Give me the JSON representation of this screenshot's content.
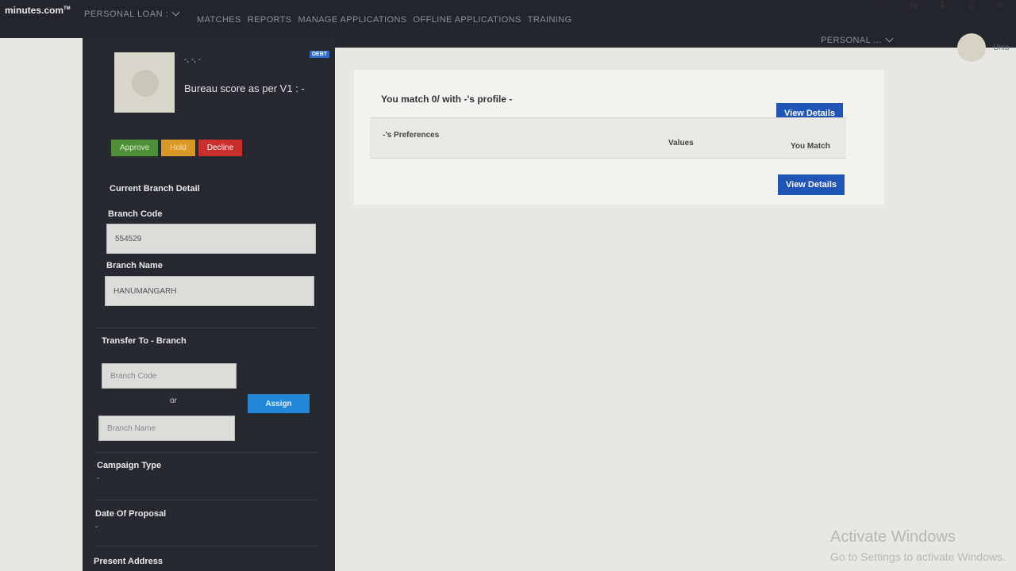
{
  "browser": {
    "icons": [
      "star-icon",
      "reader-icon",
      "download-icon",
      "home-icon",
      "menu-icon"
    ]
  },
  "nav": {
    "logo": "minutes.com",
    "logo_tm": "TM",
    "product": "PERSONAL LOAN :",
    "links": [
      "MATCHES",
      "REPORTS",
      "MANAGE APPLICATIONS",
      "OFFLINE APPLICATIONS",
      "TRAINING"
    ],
    "user_menu": "PERSONAL ...",
    "user_name": "Unio"
  },
  "sidebar": {
    "profile_dots": "-, -, -",
    "badge": "DEBT",
    "bureau_score": "Bureau score as per V1 : -",
    "actions": {
      "approve": "Approve",
      "hold": "Hold",
      "decline": "Decline"
    },
    "current_branch_title": "Current Branch Detail",
    "branch_code_label": "Branch Code",
    "branch_code_value": "554529",
    "branch_name_label": "Branch Name",
    "branch_name_value": "HANUMANGARH",
    "transfer_title": "Transfer To - Branch",
    "transfer_code_placeholder": "Branch Code",
    "or_text": "or",
    "assign_label": "Assign",
    "transfer_name_placeholder": "Branch Name",
    "campaign_label": "Campaign Type",
    "campaign_value": "-",
    "date_label": "Date Of Proposal",
    "date_value": "-",
    "address_label": "Present Address"
  },
  "main": {
    "match_title": "You match 0/ with -'s profile -",
    "view_details_1": "View Details",
    "view_details_2": "View Details",
    "table": {
      "col_preferences": "-'s Preferences",
      "col_values": "Values",
      "col_match": "You Match"
    }
  },
  "watermark": {
    "line1": "Activate Windows",
    "line2": "Go to Settings to activate Windows."
  },
  "colors": {
    "nav_bg": "#23252c",
    "sidebar_bg": "#262930",
    "approve": "#4f8f3a",
    "hold": "#d99726",
    "decline": "#c9302c",
    "assign": "#2188d8",
    "view_details": "#1f55b6"
  }
}
